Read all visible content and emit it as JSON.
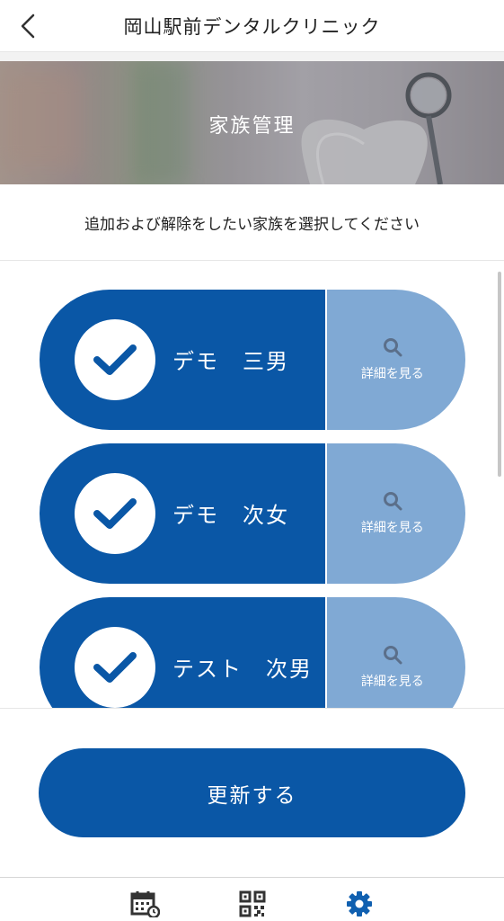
{
  "header": {
    "title": "岡山駅前デンタルクリニック",
    "back_icon": "chevron-left-icon"
  },
  "banner": {
    "title": "家族管理"
  },
  "instruction": "追加および解除をしたい家族を選択してください",
  "members": [
    {
      "name": "デモ　三男",
      "checked": true,
      "detail_label": "詳細を見る"
    },
    {
      "name": "デモ　次女",
      "checked": true,
      "detail_label": "詳細を見る"
    },
    {
      "name": "テスト　次男",
      "checked": true,
      "detail_label": "詳細を見る"
    }
  ],
  "update_button": "更新する",
  "nav": [
    {
      "icon": "calendar-clock-icon",
      "active": false
    },
    {
      "icon": "qr-code-icon",
      "active": false
    },
    {
      "icon": "gear-icon",
      "active": true
    }
  ],
  "colors": {
    "primary": "#0a57a6",
    "detail": "#80a9d4",
    "active_icon": "#1060b0",
    "inactive_icon": "#333333"
  }
}
